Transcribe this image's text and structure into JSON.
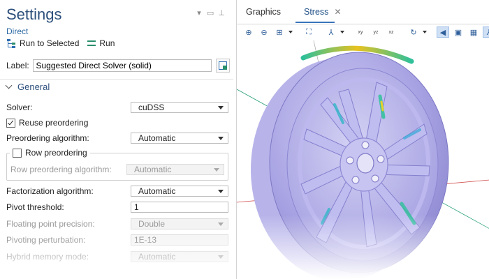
{
  "settings": {
    "title": "Settings",
    "subtitle": "Direct",
    "toolbar": {
      "run_to_selected": "Run to Selected",
      "run": "Run"
    },
    "label_field": {
      "label": "Label:",
      "value": "Suggested Direct Solver (solid)"
    },
    "section": "General",
    "solver": {
      "label": "Solver:",
      "value": "cuDSS"
    },
    "reuse_preordering": {
      "label": "Reuse preordering",
      "checked": true
    },
    "preordering_algorithm": {
      "label": "Preordering algorithm:",
      "value": "Automatic"
    },
    "row_preordering": {
      "label": "Row preordering",
      "checked": false
    },
    "row_preordering_algorithm": {
      "label": "Row preordering algorithm:",
      "value": "Automatic"
    },
    "factorization_algorithm": {
      "label": "Factorization algorithm:",
      "value": "Automatic"
    },
    "pivot_threshold": {
      "label": "Pivot threshold:",
      "value": "1"
    },
    "floating_point_precision": {
      "label": "Floating point precision:",
      "value": "Double"
    },
    "pivoting_perturbation": {
      "label": "Pivoting perturbation:",
      "value": "1E-13"
    },
    "hybrid_memory_mode": {
      "label": "Hybrid memory mode:",
      "value": "Automatic"
    }
  },
  "graphics": {
    "tabs": [
      {
        "label": "Graphics"
      },
      {
        "label": "Stress"
      }
    ],
    "active_tab": "Stress",
    "toolbar_icons": [
      "zoom-in-icon",
      "zoom-out-icon",
      "zoom-box-icon",
      "zoom-extents-icon",
      "axis-orientation-icon",
      "view-xy-icon",
      "view-yz-icon",
      "view-xz-icon",
      "rotate-icon",
      "scene-light-icon",
      "transparency-icon",
      "wireframe-icon",
      "axis-display-icon"
    ],
    "colors": {
      "accent": "#3b73b9",
      "wheel": "#a7a2e4",
      "stress_high": "#f0a020",
      "stress_mid": "#28c08a"
    }
  }
}
